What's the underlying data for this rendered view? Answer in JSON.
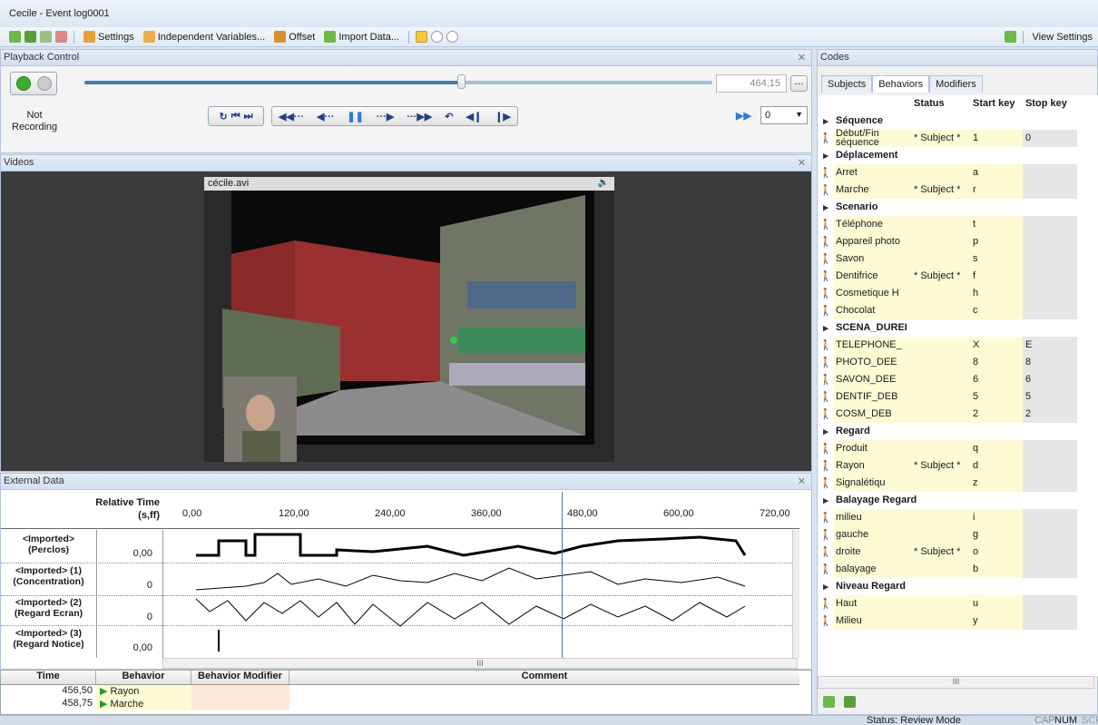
{
  "window": {
    "title": "Cecile - Event log0001"
  },
  "toolbar": {
    "settings": "Settings",
    "independent_variables": "Independent Variables...",
    "offset": "Offset",
    "import_data": "Import Data...",
    "view_settings": "View Settings"
  },
  "playback": {
    "header": "Playback Control",
    "recording_status": "Not Recording",
    "time_value": "464,15",
    "speed_value": "0",
    "slider_progress": 0.6
  },
  "videos": {
    "header": "Videos",
    "file_name": "cécile.avi"
  },
  "external": {
    "header": "External Data",
    "axis_title": "Relative Time",
    "axis_unit": "(s,ff)",
    "ticks": [
      "0,00",
      "120,00",
      "240,00",
      "360,00",
      "480,00",
      "600,00",
      "720,00"
    ],
    "rows": [
      {
        "label": "<Imported> (Perclos)",
        "value": "0,00"
      },
      {
        "label": "<Imported> (1) (Concentration)",
        "value": "0"
      },
      {
        "label": "<Imported> (2) (Regard Ecran)",
        "value": "0"
      },
      {
        "label": "<Imported> (3) (Regard Notice)",
        "value": "0,00"
      }
    ],
    "scroll_mark": "III",
    "cursor_time": 464.15
  },
  "event_grid": {
    "columns": [
      "Time",
      "Behavior",
      "Behavior Modifier",
      "Comment"
    ],
    "rows": [
      {
        "time": "456,50",
        "behavior": "Rayon"
      },
      {
        "time": "458,75",
        "behavior": "Marche"
      }
    ]
  },
  "codes": {
    "header": "Codes",
    "tabs": [
      "Subjects",
      "Behaviors",
      "Modifiers"
    ],
    "columns": [
      "Status",
      "Start key",
      "Stop key"
    ],
    "rows": [
      {
        "type": "group",
        "name": "Séquence"
      },
      {
        "type": "behavior",
        "name": "Début/Fin séquence",
        "status": "* Subject *",
        "start": "1",
        "stop": "0"
      },
      {
        "type": "group",
        "name": "Déplacement"
      },
      {
        "type": "behavior",
        "name": "Arret",
        "status": "",
        "start": "a",
        "stop": ""
      },
      {
        "type": "behavior",
        "name": "Marche",
        "status": "* Subject *",
        "start": "r",
        "stop": ""
      },
      {
        "type": "group",
        "name": "Scenario"
      },
      {
        "type": "behavior",
        "name": "Téléphone",
        "status": "",
        "start": "t",
        "stop": ""
      },
      {
        "type": "behavior",
        "name": "Appareil photo",
        "status": "",
        "start": "p",
        "stop": ""
      },
      {
        "type": "behavior",
        "name": "Savon",
        "status": "",
        "start": "s",
        "stop": ""
      },
      {
        "type": "behavior",
        "name": "Dentifrice",
        "status": "* Subject *",
        "start": "f",
        "stop": ""
      },
      {
        "type": "behavior",
        "name": "Cosmetique H",
        "status": "",
        "start": "h",
        "stop": ""
      },
      {
        "type": "behavior",
        "name": "Chocolat",
        "status": "",
        "start": "c",
        "stop": ""
      },
      {
        "type": "group",
        "name": "SCENA_DUREI"
      },
      {
        "type": "behavior",
        "name": "TELEPHONE_",
        "status": "",
        "start": "X",
        "stop": "E"
      },
      {
        "type": "behavior",
        "name": "PHOTO_DEE",
        "status": "",
        "start": "8",
        "stop": "8"
      },
      {
        "type": "behavior",
        "name": "SAVON_DEE",
        "status": "",
        "start": "6",
        "stop": "6"
      },
      {
        "type": "behavior",
        "name": "DENTIF_DEB",
        "status": "",
        "start": "5",
        "stop": "5"
      },
      {
        "type": "behavior",
        "name": "COSM_DEB",
        "status": "",
        "start": "2",
        "stop": "2"
      },
      {
        "type": "group",
        "name": "Regard"
      },
      {
        "type": "behavior",
        "name": "Produit",
        "status": "",
        "start": "q",
        "stop": ""
      },
      {
        "type": "behavior",
        "name": "Rayon",
        "status": "* Subject *",
        "start": "d",
        "stop": ""
      },
      {
        "type": "behavior",
        "name": "Signalétiqu",
        "status": "",
        "start": "z",
        "stop": ""
      },
      {
        "type": "group",
        "name": "Balayage Regard"
      },
      {
        "type": "behavior",
        "name": "milieu",
        "status": "",
        "start": "i",
        "stop": ""
      },
      {
        "type": "behavior",
        "name": "gauche",
        "status": "",
        "start": "g",
        "stop": ""
      },
      {
        "type": "behavior",
        "name": "droite",
        "status": "* Subject *",
        "start": "o",
        "stop": ""
      },
      {
        "type": "behavior",
        "name": "balayage",
        "status": "",
        "start": "b",
        "stop": ""
      },
      {
        "type": "group",
        "name": "Niveau Regard"
      },
      {
        "type": "behavior",
        "name": "Haut",
        "status": "",
        "start": "u",
        "stop": ""
      },
      {
        "type": "behavior",
        "name": "Milieu",
        "status": "",
        "start": "y",
        "stop": ""
      }
    ],
    "hscroll_mark": "III"
  },
  "status": {
    "mode": "Status: Review Mode",
    "cap": "CAP",
    "num": "NUM",
    "scrl": "SCRL"
  }
}
